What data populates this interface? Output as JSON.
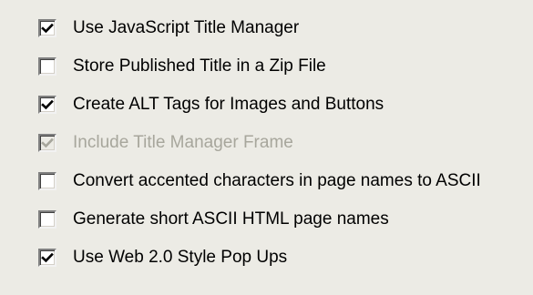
{
  "options": [
    {
      "label": "Use JavaScript Title Manager",
      "checked": true,
      "disabled": false
    },
    {
      "label": "Store Published Title in a Zip File",
      "checked": false,
      "disabled": false
    },
    {
      "label": "Create ALT Tags for Images and Buttons",
      "checked": true,
      "disabled": false
    },
    {
      "label": "Include Title Manager Frame",
      "checked": true,
      "disabled": true
    },
    {
      "label": "Convert accented characters in page names to ASCII",
      "checked": false,
      "disabled": false
    },
    {
      "label": "Generate short ASCII HTML page names",
      "checked": false,
      "disabled": false
    },
    {
      "label": "Use Web 2.0 Style Pop Ups",
      "checked": true,
      "disabled": false
    }
  ],
  "icons": {
    "check": "checkmark-icon"
  },
  "colors": {
    "background": "#ecebe5",
    "text": "#000000",
    "disabled_text": "#a7a69c",
    "check": "#000000",
    "disabled_check": "#a7a69c"
  }
}
